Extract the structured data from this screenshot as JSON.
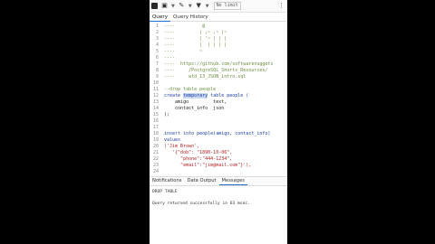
{
  "toolbar": {
    "open_icon": "folder-icon",
    "save_icon": "save-icon",
    "edit_icon": "pencil-icon",
    "filter_icon": "filter-icon",
    "limit_select": "No limit",
    "more_icon": "ellipsis-icon"
  },
  "tabs": [
    {
      "label": "Query",
      "active": true
    },
    {
      "label": "Query History",
      "active": false
    }
  ],
  "code_lines": [
    {
      "n": "1",
      "text": "----          @"
    },
    {
      "n": "2",
      "text": "----         | ,~ ,~ |~"
    },
    {
      "n": "3",
      "text": "----         | '~ | | |"
    },
    {
      "n": "4",
      "text": "----         |  | | | |"
    },
    {
      "n": "5",
      "text": "----         ~"
    },
    {
      "n": "6",
      "text": "----"
    },
    {
      "n": "7",
      "text": "----  https://github.com/softwarenuggets"
    },
    {
      "n": "8",
      "text": "----     /PostgreSQL_Shorts_Resources/"
    },
    {
      "n": "9",
      "text": "----     wtd_13_JSON_intro.sql"
    },
    {
      "n": "10",
      "text": ""
    },
    {
      "n": "11",
      "text": "--drop table people"
    },
    {
      "n": "12",
      "pre": "create ",
      "temp": "temporary",
      "post": " table people ("
    },
    {
      "n": "13",
      "text": "    amigo         text,"
    },
    {
      "n": "14",
      "text": "    contact_info  json"
    },
    {
      "n": "15",
      "text": ");"
    },
    {
      "n": "16",
      "text": ""
    },
    {
      "n": "17",
      "text": ""
    },
    {
      "n": "18",
      "text": "insert into people(amigo, contact_info)"
    },
    {
      "n": "19",
      "text": "values"
    },
    {
      "n": "20",
      "text": "('Jim Brown',"
    },
    {
      "n": "21",
      "text": "   '{\"dob\": \"1890-10-06\","
    },
    {
      "n": "22",
      "text": "      \"phone\":\"444-1234\","
    },
    {
      "n": "23",
      "text": "      \"email\":\"jim@mail.com\"}'),"
    },
    {
      "n": "24",
      "text": ""
    }
  ],
  "output_tabs": [
    {
      "label": "Notifications",
      "active": false
    },
    {
      "label": "Data Output",
      "active": false
    },
    {
      "label": "Messages",
      "active": true
    }
  ],
  "messages": {
    "line1": "DROP TABLE",
    "line2": "Query returned successfully in 63 msec."
  }
}
